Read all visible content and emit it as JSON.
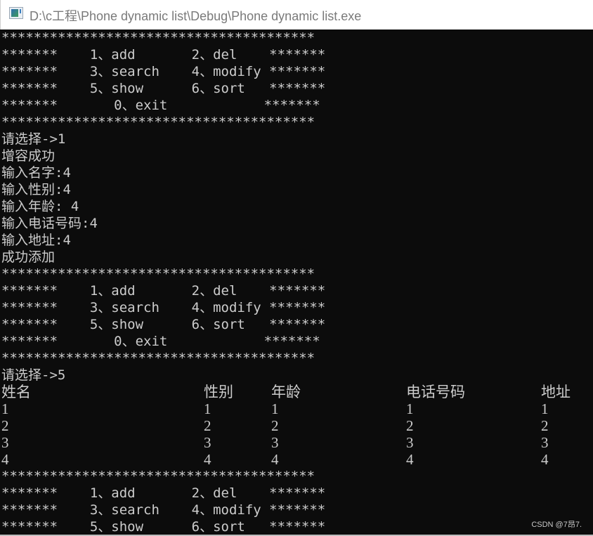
{
  "window": {
    "title": "D:\\c工程\\Phone dynamic list\\Debug\\Phone dynamic list.exe",
    "icon": "console-app-icon"
  },
  "menu": {
    "border": "***************************************",
    "rows": [
      "*******    1、add       2、del    *******",
      "*******    3、search    4、modify *******",
      "*******    5、show      6、sort   *******",
      "*******       0、exit            *******"
    ]
  },
  "session1": {
    "prompt": "请选择->1",
    "lines": [
      "增容成功",
      "输入名字:4",
      "输入性别:4",
      "输入年龄: 4",
      "输入电话号码:4",
      "输入地址:4",
      "成功添加"
    ]
  },
  "session2": {
    "prompt": "请选择->5",
    "table": {
      "headers": [
        "姓名",
        "性别",
        "年龄",
        "电话号码",
        "地址"
      ],
      "rows": [
        [
          "1",
          "1",
          "1",
          "1",
          "1"
        ],
        [
          "2",
          "2",
          "2",
          "2",
          "2"
        ],
        [
          "3",
          "3",
          "3",
          "3",
          "3"
        ],
        [
          "4",
          "4",
          "4",
          "4",
          "4"
        ]
      ]
    }
  },
  "watermark": "CSDN @7昂7.",
  "colors": {
    "console_bg": "#0c0c0c",
    "console_fg": "#cccccc",
    "title_fg": "#7a7a7a"
  }
}
